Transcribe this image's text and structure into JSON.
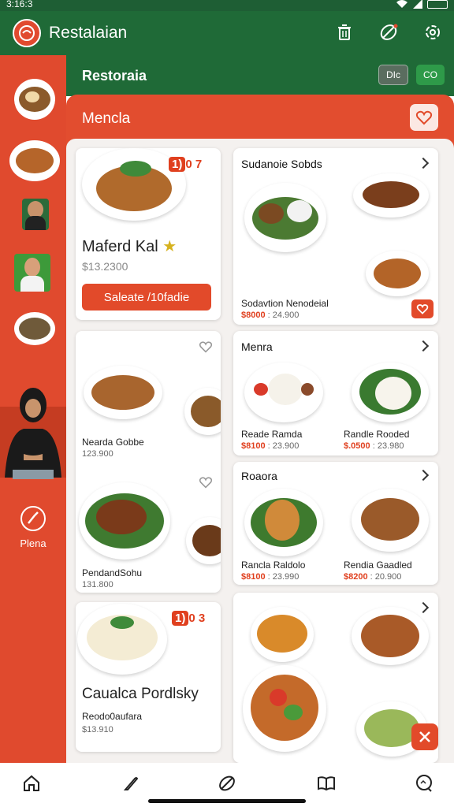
{
  "status": {
    "time": "3:16:3"
  },
  "app": {
    "title": "Restalaian"
  },
  "header": {
    "title": "Restoraia",
    "btn_a": "DIc",
    "btn_b": "CO"
  },
  "rail": {
    "menu_label": "Plena"
  },
  "panel": {
    "title": "Mencla"
  },
  "featured_top": {
    "name": "Maferd Kal",
    "star": "★",
    "price": "$13.2300",
    "button": "Saleate /10fadie",
    "badge_a": "1)",
    "badge_b": "0",
    "badge_c": "7"
  },
  "sections": [
    {
      "title": "Sudanoie Sobds",
      "items": [
        {
          "name": "Sodavtion Nenodeial",
          "price_red": "$8000",
          "price": " : 24.900"
        }
      ]
    },
    {
      "title": "Menra",
      "items": [
        {
          "name": "Reade Ramda",
          "price_red": "$8100",
          "price": " : 23.900"
        },
        {
          "name": "Randle Rooded",
          "price_red": "$.0500",
          "price": " : 23.980"
        }
      ]
    },
    {
      "title": "Roaora",
      "items": [
        {
          "name": "Rancla Raldolo",
          "price_red": "$8100",
          "price": " : 23.990"
        },
        {
          "name": "Rendia Gaadled",
          "price_red": "$8200",
          "price": " : 20.900"
        }
      ]
    }
  ],
  "left_list": [
    {
      "name": "Nearda Gobbe",
      "price": "123.900"
    },
    {
      "name": "PendandSohu",
      "price": "131.800"
    }
  ],
  "featured_bottom": {
    "name": "Caualca Pordlsky",
    "sub": "Reodo0aufara",
    "price": "$13.910",
    "badge_a": "1)",
    "badge_b": "0",
    "badge_c": "3"
  },
  "icons": {
    "delete": "trash-icon",
    "leaf": "leaf-icon",
    "settings": "gear-icon",
    "home": "home-icon",
    "edit": "pen-icon",
    "explore": "leaf-nav-icon",
    "book": "book-icon",
    "chat": "chat-icon"
  },
  "colors": {
    "green": "#1f6a37",
    "red": "#e24d2f",
    "accent": "#e0401f"
  }
}
